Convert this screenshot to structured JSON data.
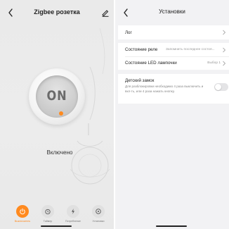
{
  "left": {
    "title": "Zigbee розетка",
    "power_button_text": "ON",
    "state_label": "Включено",
    "tabs": [
      {
        "label": "Выключатель",
        "icon": "power-icon",
        "active": true
      },
      {
        "label": "Таймер",
        "icon": "timer-icon",
        "active": false
      },
      {
        "label": "Потребление",
        "icon": "bolt-icon",
        "active": false
      },
      {
        "label": "Установки",
        "icon": "settings-icon",
        "active": false
      }
    ]
  },
  "right": {
    "title": "Установки",
    "rows": {
      "log": {
        "label": "Лог"
      },
      "relay_state": {
        "label": "Состояние реле",
        "value": "Запомнить последнее состоя..."
      },
      "led_state": {
        "label": "Состояние LED лампочки",
        "value": "Выбор 1"
      },
      "child_lock": {
        "label": "Детский замок",
        "description": "Для разблокировки необходимо 4 раза выключить и вкл-ть, или 4 раза нажать кнопку.",
        "enabled": false
      }
    }
  },
  "colors": {
    "accent": "#ff8a1f",
    "left_background": "#ececec",
    "right_background": "#f2f2f4"
  }
}
